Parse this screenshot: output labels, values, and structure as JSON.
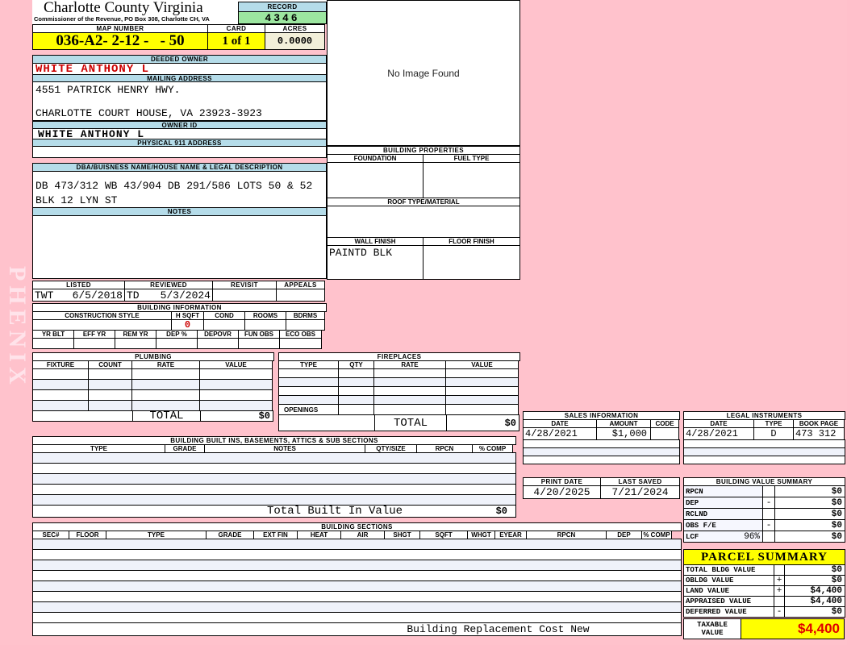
{
  "watermark": "PHENIX",
  "colors": {
    "page_bg": "#FFC2CC",
    "bar_blue": "#B5DCE9",
    "highlight_yellow": "#FFFF00",
    "record_green": "#9CE6A0",
    "acres_cream": "#F2EFD9",
    "alert_red": "#CC0000",
    "taxable_red": "#E00000",
    "row_shade": "#EFF2FA"
  },
  "header": {
    "county": "Charlotte County Virginia",
    "commissioner": "Commissioner of the Revenue, PO  Box 308, Charlotte CH, VA",
    "record_label": "RECORD",
    "record_value": "4346",
    "map_number_label": "MAP NUMBER",
    "map_number": "036-A2- 2-12 -   - 50",
    "card_label": "CARD",
    "card_value": "1 of 1",
    "acres_label": "ACRES",
    "acres_value": "0.0000"
  },
  "owner": {
    "deeded_owner_label": "DEEDED OWNER",
    "deeded_owner": "WHITE ANTHONY L",
    "mailing_address_label": "MAILING ADDRESS",
    "mailing_line1": "4551 PATRICK HENRY HWY.",
    "mailing_line2": "CHARLOTTE COURT HOUSE, VA 23923-3923",
    "owner_id_label": "OWNER ID",
    "owner_id": "WHITE ANTHONY L",
    "physical_address_label": "PHYSICAL 911 ADDRESS",
    "physical_address": ""
  },
  "image_box": {
    "text": "No Image Found"
  },
  "legal_description": {
    "dba_label": "DBA/BUISNESS NAME/HOUSE NAME & LEGAL DESCRIPTION",
    "line1": "DB 473/312 WB 43/904 DB 291/586 LOTS 50 & 52",
    "line2": "BLK 12 LYN ST",
    "notes_label": "NOTES",
    "notes": ""
  },
  "building_properties": {
    "title": "BUILDING PROPERTIES",
    "foundation_label": "FOUNDATION",
    "foundation": "",
    "fuel_type_label": "FUEL TYPE",
    "fuel_type": "",
    "roof_label": "ROOF TYPE/MATERIAL",
    "roof": "",
    "wall_finish_label": "WALL FINISH",
    "wall_finish": "PAINTD BLK",
    "floor_finish_label": "FLOOR FINISH",
    "floor_finish": ""
  },
  "visits": {
    "listed_label": "LISTED",
    "listed_by": "TWT",
    "listed_date": "6/5/2018",
    "reviewed_label": "REVIEWED",
    "reviewed_by": "TD",
    "reviewed_date": "5/3/2024",
    "revisit_label": "REVISIT",
    "revisit": "",
    "appeals_label": "APPEALS",
    "appeals": ""
  },
  "building_info": {
    "title": "BUILDING INFORMATION",
    "construction_style_label": "CONSTRUCTION STYLE",
    "hsqft_label": "H SQFT",
    "hsqft": "0",
    "cond_label": "COND",
    "rooms_label": "ROOMS",
    "bdrms_label": "BDRMS",
    "yr_blt_label": "YR BLT",
    "eff_yr_label": "EFF YR",
    "rem_yr_label": "REM YR",
    "dep_label": "DEP %",
    "depovr_label": "DEPOVR",
    "fun_obs_label": "FUN OBS",
    "eco_obs_label": "ECO OBS"
  },
  "plumbing": {
    "title": "PLUMBING",
    "columns": [
      "FIXTURE",
      "COUNT",
      "RATE",
      "VALUE"
    ],
    "total_label": "TOTAL",
    "total_value": "$0"
  },
  "fireplaces": {
    "title": "FIREPLACES",
    "columns": [
      "TYPE",
      "QTY",
      "RATE",
      "VALUE"
    ],
    "openings_label": "OPENINGS",
    "total_label": "TOTAL",
    "total_value": "$0"
  },
  "built_ins": {
    "title": "BUILDING BUILT INS, BASEMENTS, ATTICS & SUB SECTIONS",
    "columns": [
      "TYPE",
      "GRADE",
      "NOTES",
      "QTY/SIZE",
      "RPCN",
      "% COMP"
    ],
    "total_label": "Total Built In Value",
    "total_value": "$0"
  },
  "building_sections": {
    "title": "BUILDING SECTIONS",
    "columns": [
      "SEC#",
      "FLOOR",
      "TYPE",
      "GRADE",
      "EXT FIN",
      "HEAT",
      "AIR",
      "SHGT",
      "SQFT",
      "WHGT",
      "EYEAR",
      "RPCN",
      "DEP",
      "% COMP"
    ],
    "footer": "Building Replacement Cost New"
  },
  "sales": {
    "title": "SALES INFORMATION",
    "columns": [
      "DATE",
      "AMOUNT",
      "CODE"
    ],
    "rows": [
      {
        "date": "4/28/2021",
        "amount": "$1,000",
        "code": ""
      }
    ]
  },
  "legal_instruments": {
    "title": "LEGAL INSTRUMENTS",
    "columns": [
      "DATE",
      "TYPE",
      "BOOK PAGE"
    ],
    "rows": [
      {
        "date": "4/28/2021",
        "type": "D",
        "book_page": "473 312"
      }
    ]
  },
  "dates": {
    "print_date_label": "PRINT DATE",
    "print_date": "4/20/2025",
    "last_saved_label": "LAST SAVED",
    "last_saved": "7/21/2024"
  },
  "value_summary": {
    "title": "BUILDING VALUE SUMMARY",
    "rows": [
      {
        "label": "RPCN",
        "extra": "",
        "op": "",
        "value": "$0"
      },
      {
        "label": "DEP",
        "extra": "",
        "op": "-",
        "value": "$0"
      },
      {
        "label": "RCLND",
        "extra": "",
        "op": "",
        "value": "$0"
      },
      {
        "label": "OBS F/E",
        "extra": "",
        "op": "-",
        "value": "$0"
      },
      {
        "label": "LCF",
        "extra": "96%",
        "op": "",
        "value": "$0"
      }
    ]
  },
  "parcel_summary": {
    "title": "PARCEL SUMMARY",
    "rows": [
      {
        "label": "TOTAL BLDG VALUE",
        "op": "",
        "value": "$0"
      },
      {
        "label": "OBLDG VALUE",
        "op": "+",
        "value": "$0"
      },
      {
        "label": "LAND VALUE",
        "op": "+",
        "value": "$4,400"
      },
      {
        "label": "APPRAISED VALUE",
        "op": "",
        "value": "$4,400"
      },
      {
        "label": "DEFERRED VALUE",
        "op": "-",
        "value": "$0"
      }
    ],
    "taxable_label": "TAXABLE VALUE",
    "taxable_value": "$4,400"
  }
}
